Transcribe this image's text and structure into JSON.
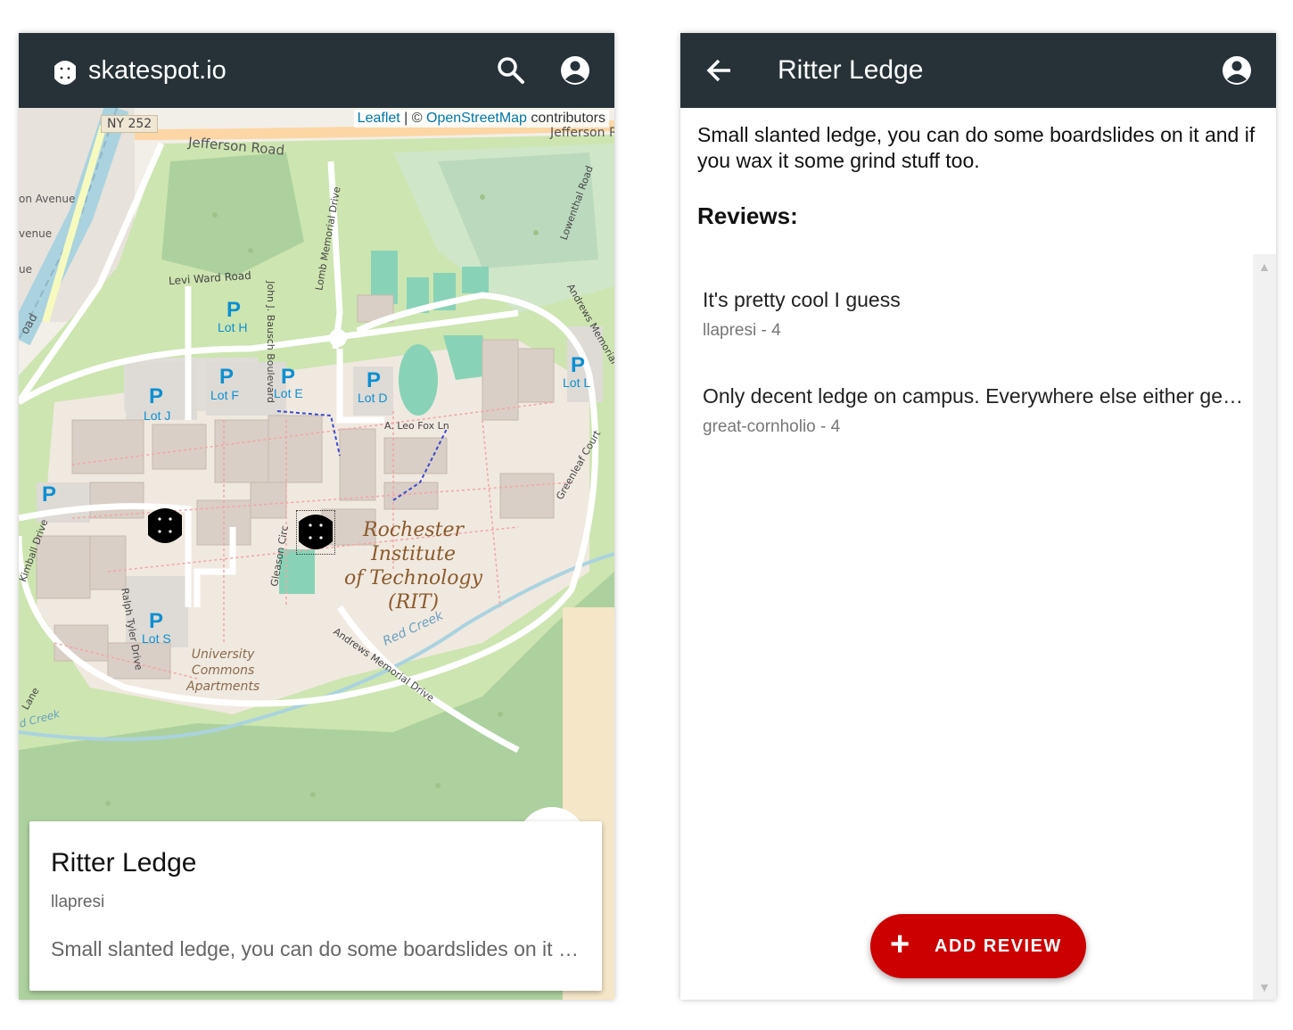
{
  "left_screen": {
    "app_title": "skatespot.io",
    "icons": {
      "logo": "skateboard-logo-icon",
      "search": "search-icon",
      "account": "account-circle-icon"
    },
    "map": {
      "attribution_leaflet": "Leaflet",
      "attribution_sep": " | © ",
      "attribution_osm": "OpenStreetMap",
      "attribution_tail": " contributors",
      "labels": {
        "ny252": "NY 252",
        "jefferson_road": "Jefferson Road",
        "jefferson_r": "Jefferson R",
        "on_avenue": "on Avenue",
        "venue": "venue",
        "ue": "ue",
        "levi_ward": "Levi Ward Road",
        "john_bausch": "John J. Bausch Boulevard",
        "lomb_memorial": "Lomb Memorial Drive",
        "lowenthal": "Lowenthal Road",
        "andrews_top": "Andrews Memorial Drive",
        "a_leo_fox": "A. Leo Fox Ln",
        "greenleaf": "Greenleaf Court",
        "kimball": "Kimball Drive",
        "ralph_tyler": "Ralph Tyler Drive",
        "gleason": "Gleason Circ",
        "andrews_bottom": "Andrews Memorial Drive",
        "red_creek": "Red Creek",
        "lane": "Lane",
        "d_creek": "d Creek",
        "oad": "oad",
        "university_commons": [
          "University",
          "Commons",
          "Apartments"
        ],
        "rit": [
          "Rochester",
          "Institute",
          "of Technology",
          "(RIT)"
        ]
      },
      "parking": {
        "symbol": "P",
        "lots": [
          "Lot H",
          "Lot F",
          "Lot E",
          "Lot D",
          "Lot J",
          "Lot L",
          "Lot S",
          ""
        ]
      },
      "markers": [
        "skatespot-marker-1",
        "skatespot-marker-2"
      ]
    },
    "spot_card": {
      "title": "Ritter Ledge",
      "author": "llapresi",
      "description": "Small slanted ledge, you can do some boardslides on it and if you wax it some grind stuff too."
    }
  },
  "right_screen": {
    "title": "Ritter Ledge",
    "icons": {
      "back": "arrow-back-icon",
      "account": "account-circle-icon",
      "add": "plus-icon"
    },
    "description": "Small slanted ledge, you can do some boardslides on it and if you wax it some grind stuff too.",
    "reviews_heading": "Reviews:",
    "reviews": [
      {
        "text": "It's pretty cool I guess",
        "meta": "llapresi - 4"
      },
      {
        "text": "Only decent ledge on campus. Everywhere else either gets you kicked out or is a crusty mess.",
        "meta": "great-cornholio - 4"
      }
    ],
    "add_review_label": "ADD REVIEW",
    "colors": {
      "appbar": "#263238",
      "add_button": "#cc0000"
    }
  }
}
